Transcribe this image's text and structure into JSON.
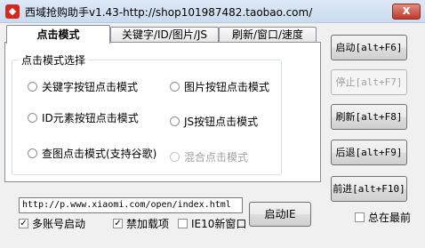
{
  "window": {
    "title": "西域抢购助手v1.43-http://shop101987482.taobao.com/",
    "close_label": "x"
  },
  "tabs": [
    {
      "label": "点击模式",
      "active": true
    },
    {
      "label": "关键字/ID/图片/JS",
      "active": false
    },
    {
      "label": "刷新/窗口/速度",
      "active": false
    }
  ],
  "group": {
    "title": "点击模式选择",
    "options": [
      {
        "label": "关键字按钮点击模式",
        "selected": false,
        "enabled": true
      },
      {
        "label": "图片按钮点击模式",
        "selected": false,
        "enabled": true
      },
      {
        "label": "ID元素按钮点击模式",
        "selected": false,
        "enabled": true
      },
      {
        "label": "JS按钮点击模式",
        "selected": false,
        "enabled": true
      },
      {
        "label": "查图点击模式(支持谷歌)",
        "selected": false,
        "enabled": true
      },
      {
        "label": "混合点击模式",
        "selected": false,
        "enabled": false
      }
    ]
  },
  "url_input": {
    "value": "http://p.www.xiaomi.com/open/index.html"
  },
  "start_ie_button": {
    "label": "启动IE"
  },
  "checkboxes": [
    {
      "label": "多账号启动",
      "checked": true
    },
    {
      "label": "禁加载项",
      "checked": true
    },
    {
      "label": "IE10新窗口",
      "checked": false
    }
  ],
  "side_buttons": [
    {
      "label": "启动[alt+F6]",
      "enabled": true
    },
    {
      "label": "停止[alt+F7]",
      "enabled": false
    },
    {
      "label": "刷新[alt+F8]",
      "enabled": true
    },
    {
      "label": "后退[alt+F9]",
      "enabled": true
    },
    {
      "label": "前进[alt+F10]",
      "enabled": true
    }
  ],
  "always_on_top": {
    "label": "总在最前",
    "checked": false
  },
  "colors": {
    "title_icon": "#d9261c",
    "close_button": "#c0392b",
    "disabled_text": "#a0a0a0"
  }
}
